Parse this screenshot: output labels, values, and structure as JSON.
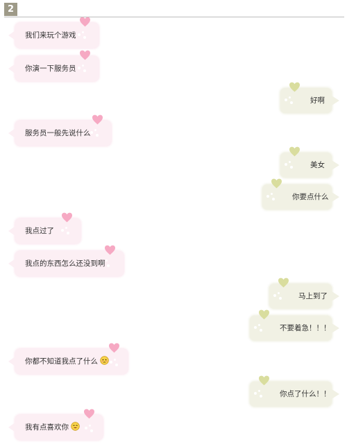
{
  "header": {
    "badge": "2"
  },
  "colors": {
    "left_bubble": "#fceff4",
    "right_bubble": "#f1f1e4",
    "pink_heart": "#f6a9c3",
    "yellow_heart": "#d9dd9e",
    "badge": "#9e9a88"
  },
  "messages": [
    {
      "side": "left",
      "text": "我们来玩个游戏"
    },
    {
      "side": "left",
      "text": "你演一下服务员"
    },
    {
      "side": "right",
      "text": "好啊"
    },
    {
      "side": "left",
      "text": "服务员一般先说什么"
    },
    {
      "side": "right",
      "text": "美女"
    },
    {
      "side": "right",
      "text": "你要点什么"
    },
    {
      "side": "left",
      "text": "我点过了"
    },
    {
      "side": "left",
      "text": "我点的东西怎么还没到啊"
    },
    {
      "side": "right",
      "text": "马上到了"
    },
    {
      "side": "right",
      "text": "不要着急！！！"
    },
    {
      "side": "left",
      "text": "你都不知道我点了什么",
      "emoji": "embarrassed-face-icon"
    },
    {
      "side": "right",
      "text": "你点了什么！！"
    },
    {
      "side": "left",
      "text": "我有点喜欢你",
      "emoji": "smiling-face-icon"
    }
  ]
}
